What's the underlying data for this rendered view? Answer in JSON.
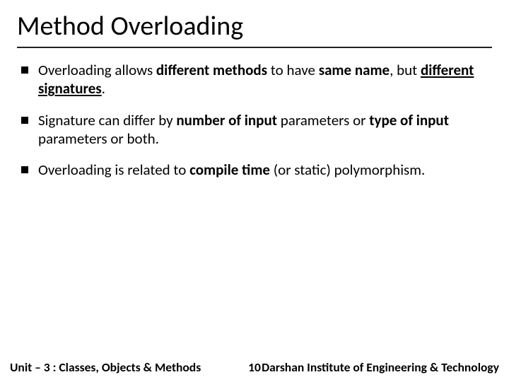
{
  "title": "Method Overloading",
  "bullets": {
    "b1a": "Overloading allows ",
    "b1b": "different methods",
    "b1c": " to have ",
    "b1d": "same name",
    "b1e": ", but ",
    "b1f": "different signatures",
    "b1g": ".",
    "b2a": "Signature can differ by ",
    "b2b": "number of input",
    "b2c": " parameters or ",
    "b2d": "type of input",
    "b2e": " parameters or both.",
    "b3a": "Overloading is related to ",
    "b3b": "compile time",
    "b3c": " (or static) polymorphism."
  },
  "footer": {
    "unit": "Unit – 3  : Classes, Objects & Methods",
    "page": "10",
    "institute": "Darshan Institute of Engineering & Technology"
  }
}
